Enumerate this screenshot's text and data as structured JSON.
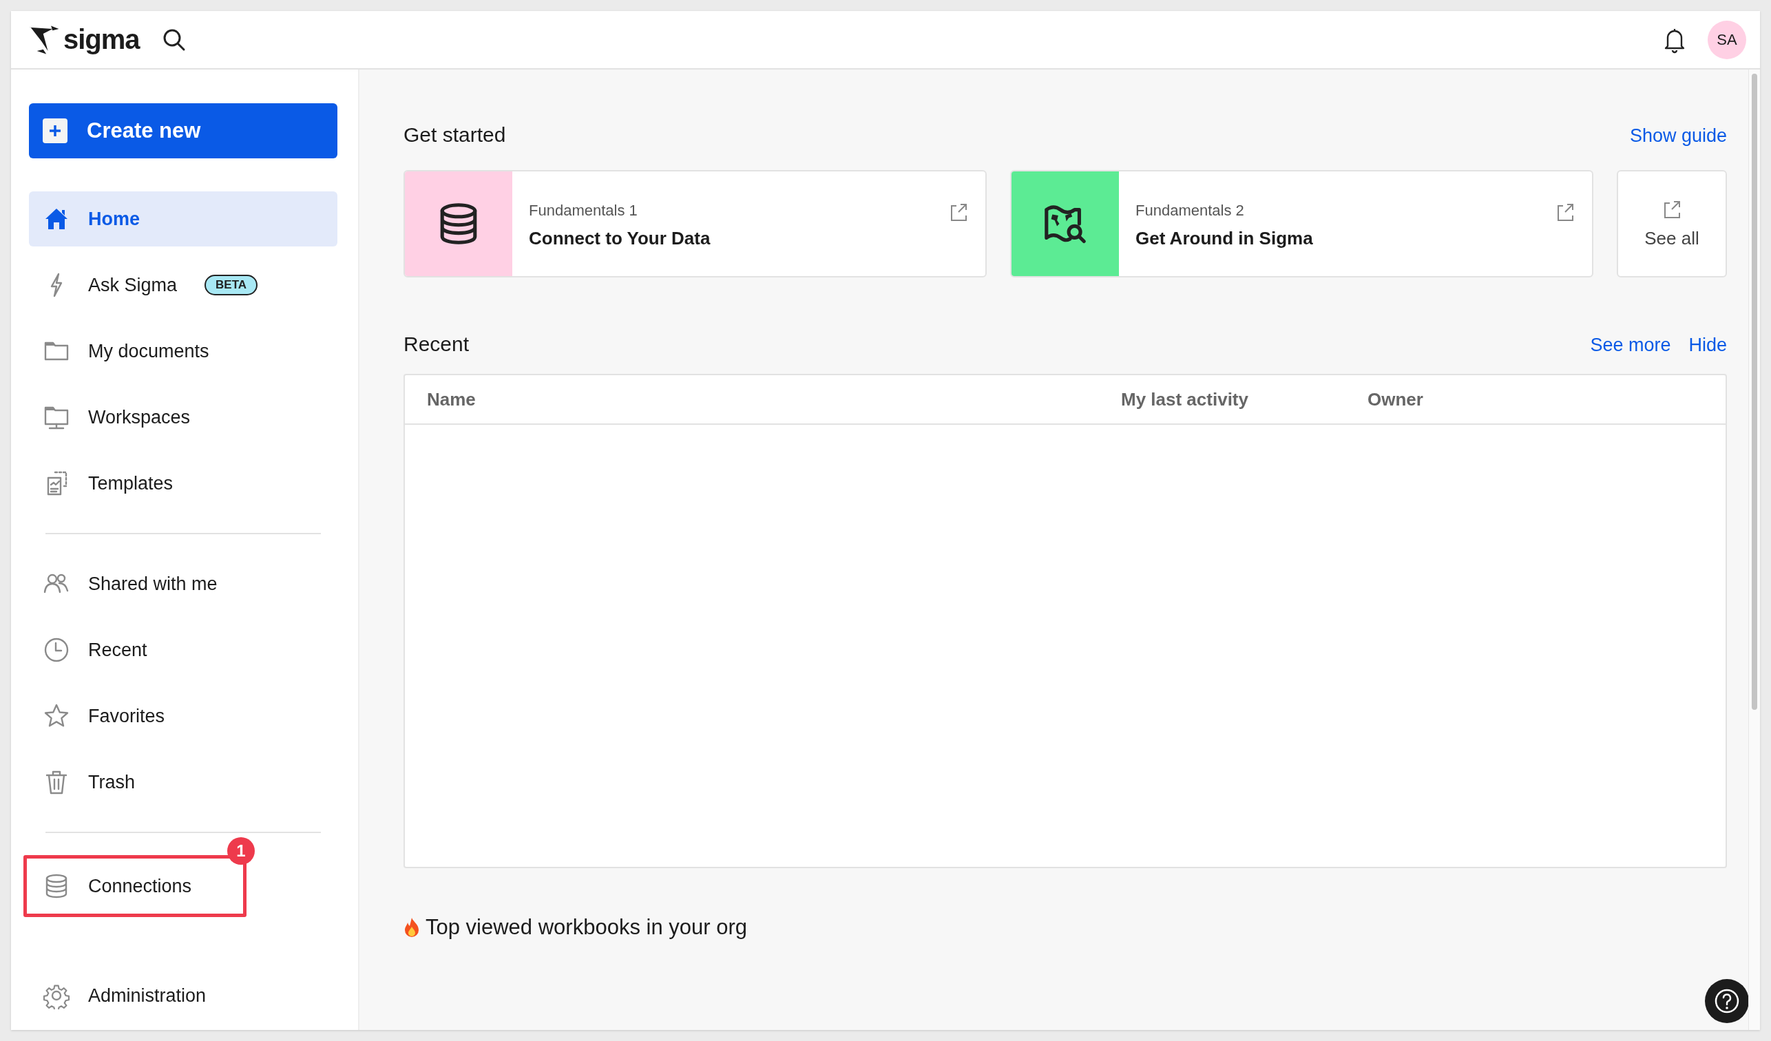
{
  "topbar": {
    "logo": "sigma",
    "avatar": "SA"
  },
  "sidebar": {
    "create_button": "Create new",
    "groups": [
      {
        "items": [
          {
            "label": "Home",
            "selected": true
          },
          {
            "label": "Ask Sigma",
            "badge": "BETA",
            "selected": false
          },
          {
            "label": "My documents",
            "selected": false
          },
          {
            "label": "Workspaces",
            "selected": false
          },
          {
            "label": "Templates",
            "selected": false
          }
        ]
      },
      {
        "items": [
          {
            "label": "Shared with me",
            "selected": false
          },
          {
            "label": "Recent",
            "selected": false
          },
          {
            "label": "Favorites",
            "selected": false
          },
          {
            "label": "Trash",
            "selected": false
          }
        ]
      },
      {
        "items": [
          {
            "label": "Connections",
            "selected": false,
            "highlighted": true,
            "callout": "1"
          }
        ]
      },
      {
        "items": [
          {
            "label": "Administration",
            "selected": false
          }
        ]
      }
    ]
  },
  "get_started": {
    "title": "Get started",
    "link": "Show guide",
    "cards": [
      {
        "subtitle": "Fundamentals 1",
        "title": "Connect to Your Data",
        "color": "#ffd0e4"
      },
      {
        "subtitle": "Fundamentals 2",
        "title": "Get Around in Sigma",
        "color": "#5ceb94"
      }
    ],
    "see_all": "See all"
  },
  "recent": {
    "title": "Recent",
    "links": [
      "See more",
      "Hide"
    ],
    "columns": [
      "Name",
      "My last activity",
      "Owner"
    ]
  },
  "top_viewed": {
    "title": "Top viewed workbooks in your org"
  }
}
